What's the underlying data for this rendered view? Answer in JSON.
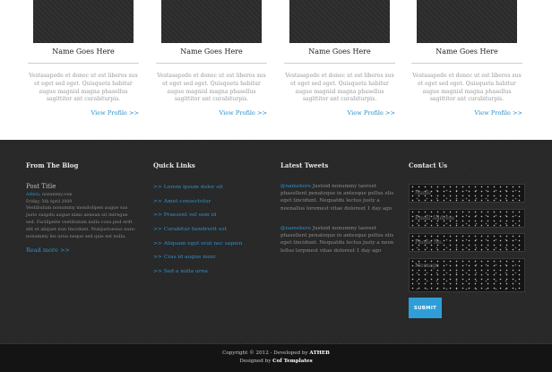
{
  "team": {
    "members": [
      {
        "name": "Name Goes Here",
        "description": "Vestasapede et donec ut est liberos sus et eget sed eget. Quisqueta habitur augue magnisl magna phasellus sagittitor ant curabiturpis.",
        "profile_link": "View Profile >>"
      },
      {
        "name": "Name Goes Here",
        "description": "Vestasapede et donec ut est liberos sus et eget sed eget. Quisqueta habitur augue magnisl magna phasellus sagittitor ant curabiturpis.",
        "profile_link": "View Profile >>"
      },
      {
        "name": "Name Goes Here",
        "description": "Vestasapede et donec ut est liberos sus et eget sed eget. Quisqueta habitur augue magnisl magna phasellus sagittitor ant curabiturpis.",
        "profile_link": "View Profile >>"
      },
      {
        "name": "Name Goes Here",
        "description": "Vestasapede et donec ut est liberos sus et eget sed eget. Quisqueta habitur augue magnisl magna phasellus sagittitor ant curabiturpis.",
        "profile_link": "View Profile >>"
      }
    ]
  },
  "footer": {
    "blog": {
      "title": "From The Blog",
      "post_title": "Post Title",
      "author": "Admin",
      "meta_rest": ", nonummy.com",
      "meta_date": "Friday, 5th April 2009",
      "excerpt": "Vestibulum nonummy mondolipen augue sus justo suspdu augue nims aenean sit intregue sed. Faclilpeite vestibulum nulla cons pnd erdt elit et aliquet non tincidunt. Nunjustoeuus nunc nonummy les urna neque sed quis est nulla.",
      "read_more": "Read more >>"
    },
    "quick_links": {
      "title": "Quick Links",
      "items": [
        ">> Lorem ipsum dolor sit",
        ">> Amet consectetur",
        ">> Praesent vel sem id",
        ">> Curabitur hendrerit est",
        ">> Aliquam eget erat nec sapien",
        ">> Cras id augue nunc",
        ">> Sed a nulla urna"
      ]
    },
    "latest_tweets": {
      "title": "Latest Tweets",
      "tweets": [
        {
          "handle": "@namehere",
          "text": " Justoid nonummy laoreet phasellent penatoque in antesque pellus elis eget tincidunt. Nequatdu lectus justy a neenallus loremest vitae doloreet",
          "time": "1 day ago"
        },
        {
          "handle": "@namehere",
          "text": " Justoid nonummy laoreet phasellent penatoque in antesque pellus elis eget tincidunt. Nequatdu lectus justy a neen lellus lorpmest vitae doloreet",
          "time": "1 day ago"
        }
      ]
    },
    "contact": {
      "title": "Contact Us",
      "name_placeholder": "Name",
      "email_placeholder": "Email Address",
      "phone_placeholder": "Phone No.",
      "message_placeholder": "Message",
      "submit_label": "SUBMIT"
    },
    "copyright": {
      "line1_prefix": "Copyright © 2012 - Developed by ",
      "line1_link": "ATHEB",
      "line2_prefix": "Designed by ",
      "line2_link": "Cof Templates"
    }
  },
  "colors": {
    "accent": "#2f90c7",
    "footer_bg": "#272727",
    "submit_bg": "#2f9ed8"
  }
}
